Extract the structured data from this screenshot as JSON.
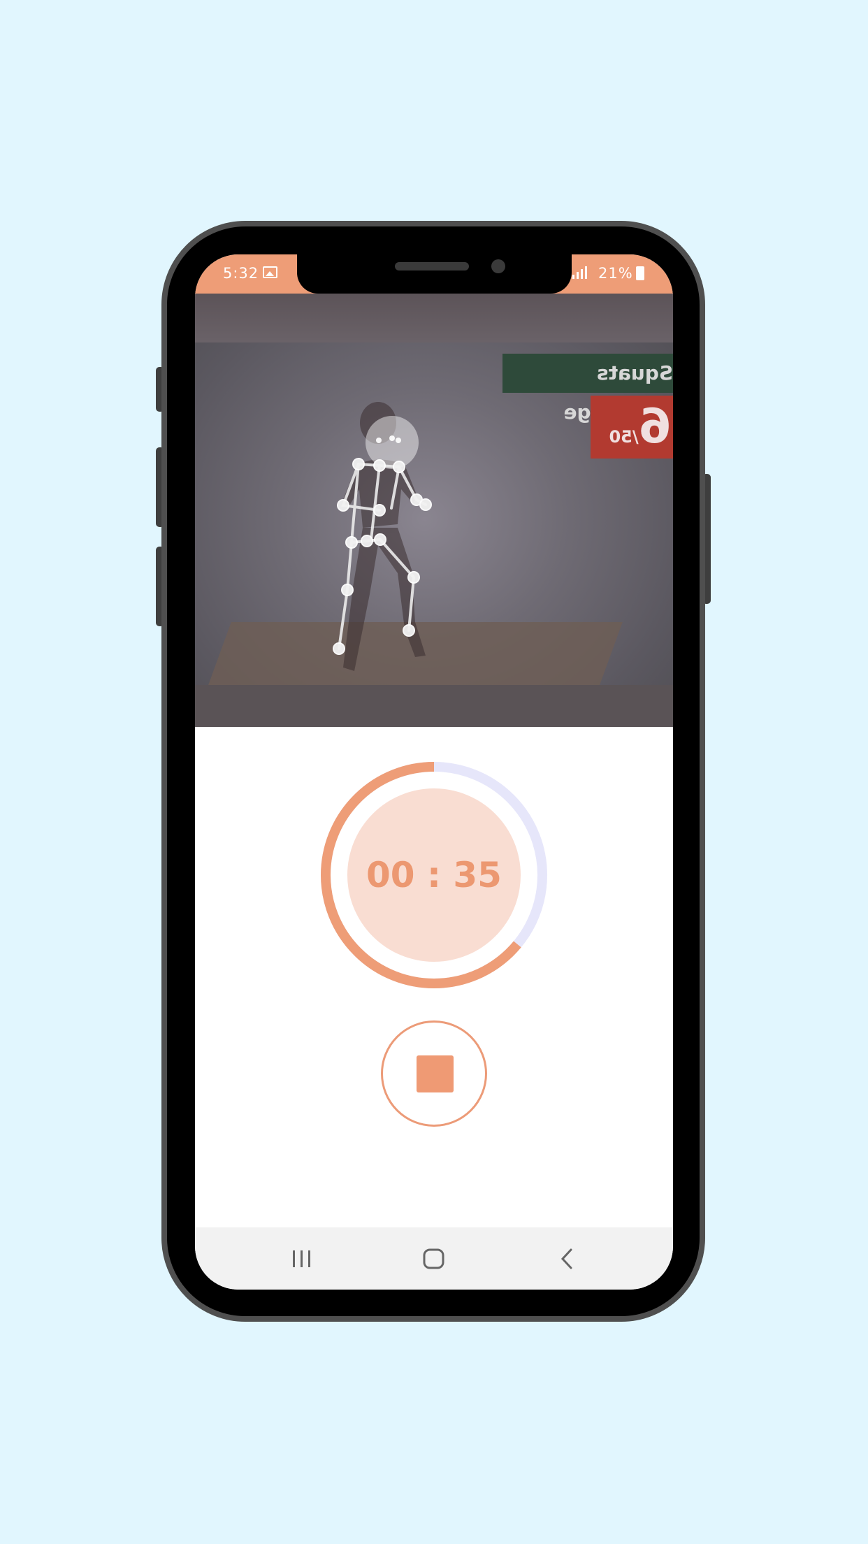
{
  "status_bar": {
    "time": "5:32",
    "battery": "21%",
    "icons": [
      "image-icon",
      "signal-icon",
      "battery-icon"
    ]
  },
  "camera_view": {
    "banner_title": "Squats Challenge",
    "counter_value": "6",
    "counter_total": "/50"
  },
  "timer": {
    "display": "00 : 35",
    "progress_fraction": 0.64,
    "accent_color": "#ee9d77",
    "track_color": "#e6e6fa",
    "inner_color": "#f9ddd2"
  },
  "controls": {
    "stop_icon": "stop-icon"
  },
  "nav_bar": {
    "icons": [
      "recent-apps-icon",
      "home-icon",
      "back-icon"
    ]
  },
  "colors": {
    "background": "#e1f6fe",
    "status_bar": "#ee9d77"
  }
}
